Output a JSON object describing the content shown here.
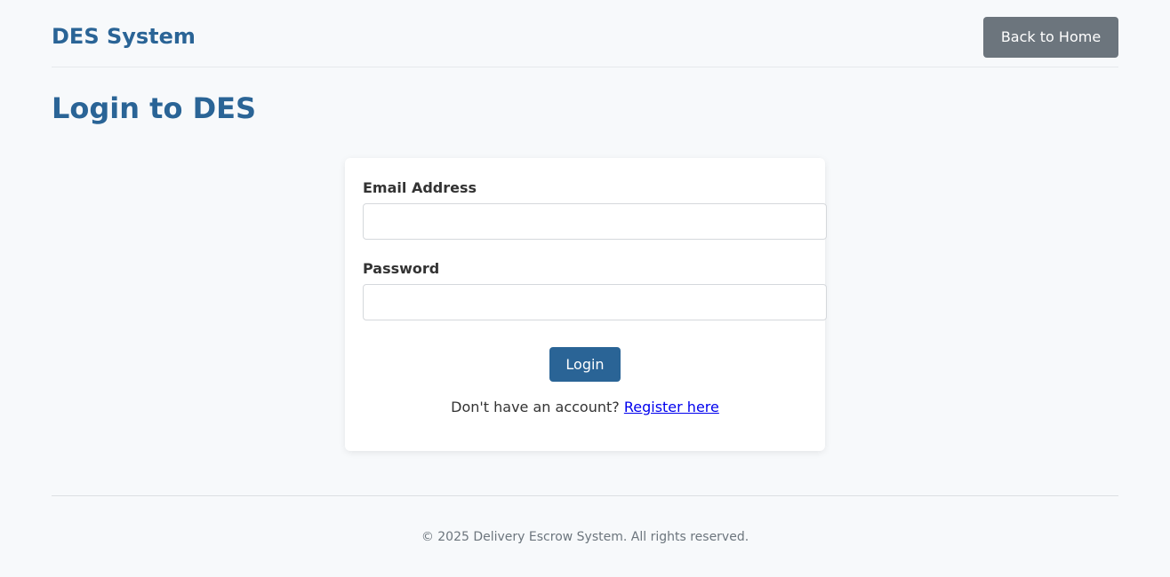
{
  "header": {
    "brand": "DES System",
    "back_button": "Back to Home"
  },
  "page": {
    "title": "Login to DES"
  },
  "form": {
    "email_label": "Email Address",
    "email_value": "",
    "password_label": "Password",
    "password_value": "",
    "login_button": "Login",
    "register_prompt": "Don't have an account?",
    "register_link": "Register here"
  },
  "footer": {
    "text": "© 2025 Delivery Escrow System. All rights reserved."
  },
  "colors": {
    "brand": "#2a6496",
    "secondary_button": "#6c757d",
    "primary_button": "#2a6496",
    "link": "#0000ee",
    "background": "#f7f9fb"
  }
}
